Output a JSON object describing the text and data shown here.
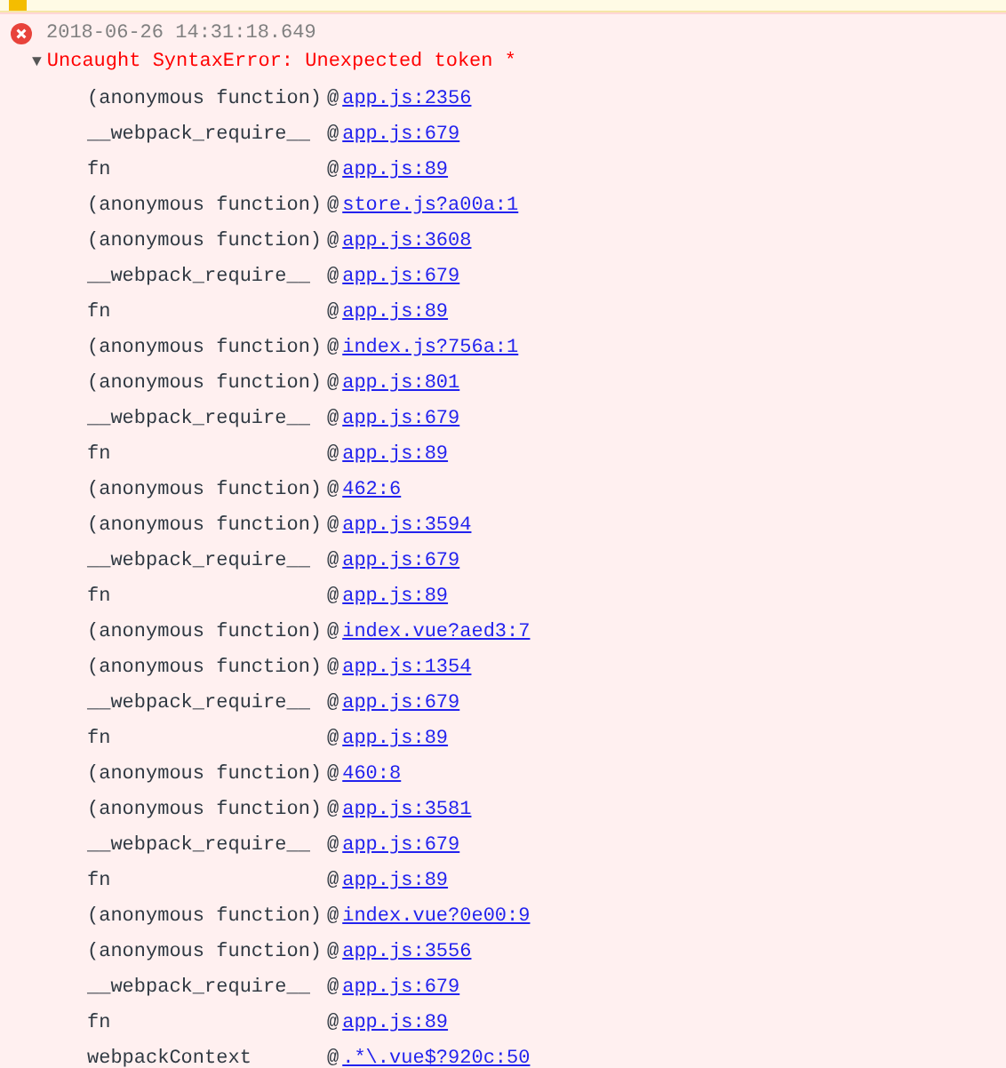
{
  "warning": {
    "visible": true
  },
  "error": {
    "timestamp": "2018-06-26 14:31:18.649",
    "expanded": true,
    "toggle": "▼",
    "message": "Uncaught SyntaxError: Unexpected token *",
    "frames": [
      {
        "function": "(anonymous function)",
        "at": "@",
        "location": "app.js:2356"
      },
      {
        "function": "__webpack_require__",
        "at": "@",
        "location": "app.js:679"
      },
      {
        "function": "fn",
        "at": "@",
        "location": "app.js:89"
      },
      {
        "function": "(anonymous function)",
        "at": "@",
        "location": "store.js?a00a:1"
      },
      {
        "function": "(anonymous function)",
        "at": "@",
        "location": "app.js:3608"
      },
      {
        "function": "__webpack_require__",
        "at": "@",
        "location": "app.js:679"
      },
      {
        "function": "fn",
        "at": "@",
        "location": "app.js:89"
      },
      {
        "function": "(anonymous function)",
        "at": "@",
        "location": "index.js?756a:1"
      },
      {
        "function": "(anonymous function)",
        "at": "@",
        "location": "app.js:801"
      },
      {
        "function": "__webpack_require__",
        "at": "@",
        "location": "app.js:679"
      },
      {
        "function": "fn",
        "at": "@",
        "location": "app.js:89"
      },
      {
        "function": "(anonymous function)",
        "at": "@",
        "location": "462:6"
      },
      {
        "function": "(anonymous function)",
        "at": "@",
        "location": "app.js:3594"
      },
      {
        "function": "__webpack_require__",
        "at": "@",
        "location": "app.js:679"
      },
      {
        "function": "fn",
        "at": "@",
        "location": "app.js:89"
      },
      {
        "function": "(anonymous function)",
        "at": "@",
        "location": "index.vue?aed3:7"
      },
      {
        "function": "(anonymous function)",
        "at": "@",
        "location": "app.js:1354"
      },
      {
        "function": "__webpack_require__",
        "at": "@",
        "location": "app.js:679"
      },
      {
        "function": "fn",
        "at": "@",
        "location": "app.js:89"
      },
      {
        "function": "(anonymous function)",
        "at": "@",
        "location": "460:8"
      },
      {
        "function": "(anonymous function)",
        "at": "@",
        "location": "app.js:3581"
      },
      {
        "function": "__webpack_require__",
        "at": "@",
        "location": "app.js:679"
      },
      {
        "function": "fn",
        "at": "@",
        "location": "app.js:89"
      },
      {
        "function": "(anonymous function)",
        "at": "@",
        "location": "index.vue?0e00:9"
      },
      {
        "function": "(anonymous function)",
        "at": "@",
        "location": "app.js:3556"
      },
      {
        "function": "__webpack_require__",
        "at": "@",
        "location": "app.js:679"
      },
      {
        "function": "fn",
        "at": "@",
        "location": "app.js:89"
      },
      {
        "function": "webpackContext",
        "at": "@",
        "location": ".*\\.vue$?920c:50"
      }
    ]
  }
}
